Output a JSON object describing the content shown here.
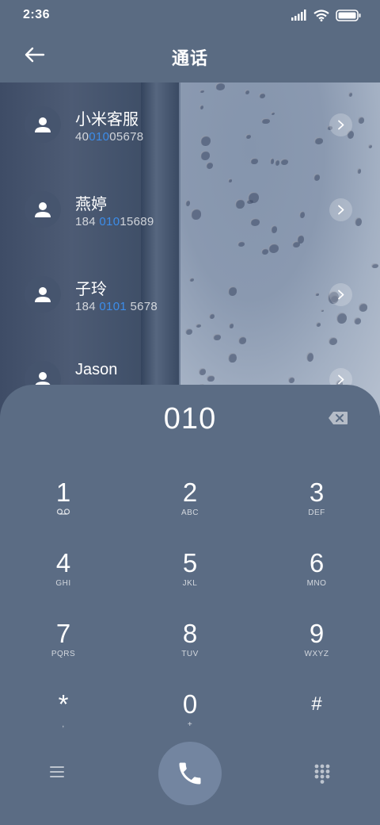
{
  "status_bar": {
    "time": "2:36",
    "icons": [
      "signal-icon",
      "wifi-icon",
      "battery-icon"
    ]
  },
  "header": {
    "title": "通话",
    "back_icon": "back-arrow-icon"
  },
  "contacts": [
    {
      "name": "小米客服",
      "number_pre": "40",
      "number_match": "010",
      "number_post": "05678"
    },
    {
      "name": "燕婷",
      "number_pre": "184 ",
      "number_match": "010",
      "number_post": "15689"
    },
    {
      "name": "子玲",
      "number_pre": "184 ",
      "number_match": "0101",
      "number_post": " 5678"
    },
    {
      "name": "Jason",
      "number_pre": "",
      "number_match": "",
      "number_post": ""
    }
  ],
  "dialpad": {
    "input_value": "010",
    "keys": [
      {
        "digit": "1",
        "letters": ""
      },
      {
        "digit": "2",
        "letters": "ABC"
      },
      {
        "digit": "3",
        "letters": "DEF"
      },
      {
        "digit": "4",
        "letters": "GHI"
      },
      {
        "digit": "5",
        "letters": "JKL"
      },
      {
        "digit": "6",
        "letters": "MNO"
      },
      {
        "digit": "7",
        "letters": "PQRS"
      },
      {
        "digit": "8",
        "letters": "TUV"
      },
      {
        "digit": "9",
        "letters": "WXYZ"
      },
      {
        "digit": "*",
        "letters": ","
      },
      {
        "digit": "0",
        "letters": "+"
      },
      {
        "digit": "#",
        "letters": ""
      }
    ]
  },
  "colors": {
    "match_highlight": "#3c8dea",
    "panel": "#5b6c84",
    "call_button": "#7385a0"
  }
}
